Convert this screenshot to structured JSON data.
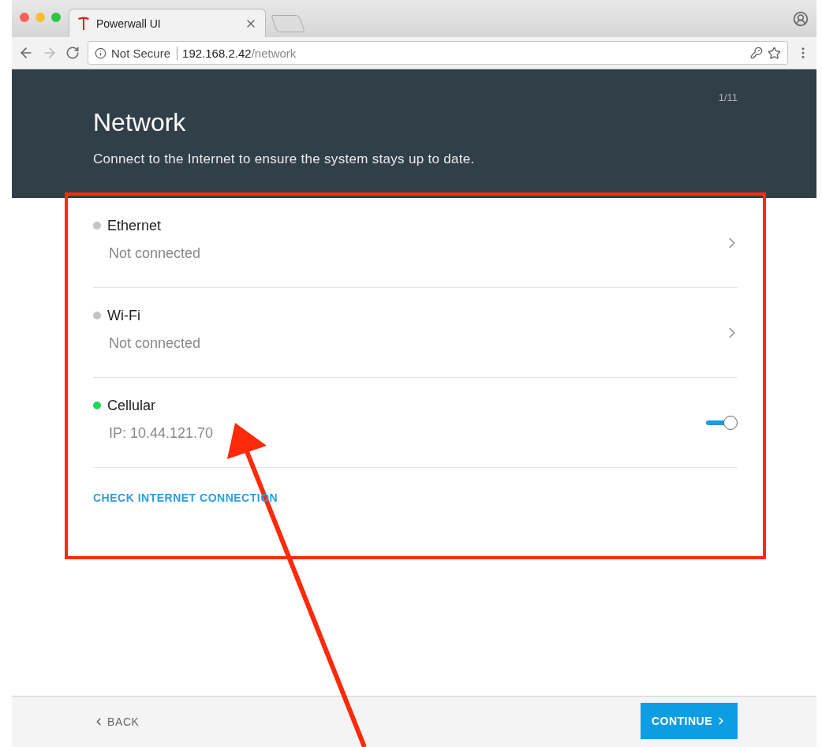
{
  "browser": {
    "tab_title": "Powerwall UI",
    "security": "Not Secure",
    "url_host": "192.168.2.42",
    "url_path": "/network"
  },
  "header": {
    "step": "1/11",
    "title": "Network",
    "subtitle": "Connect to the Internet to ensure the system stays up to date."
  },
  "connections": [
    {
      "name": "Ethernet",
      "status": "Not connected",
      "color": "#c4c4c4",
      "kind": "link"
    },
    {
      "name": "Wi-Fi",
      "status": "Not connected",
      "color": "#c4c4c4",
      "kind": "link"
    },
    {
      "name": "Cellular",
      "status": "IP: 10.44.121.70",
      "color": "#1ed760",
      "kind": "toggle",
      "on": true
    }
  ],
  "check_link": "CHECK INTERNET CONNECTION",
  "footer": {
    "back": "BACK",
    "continue": "CONTINUE"
  }
}
